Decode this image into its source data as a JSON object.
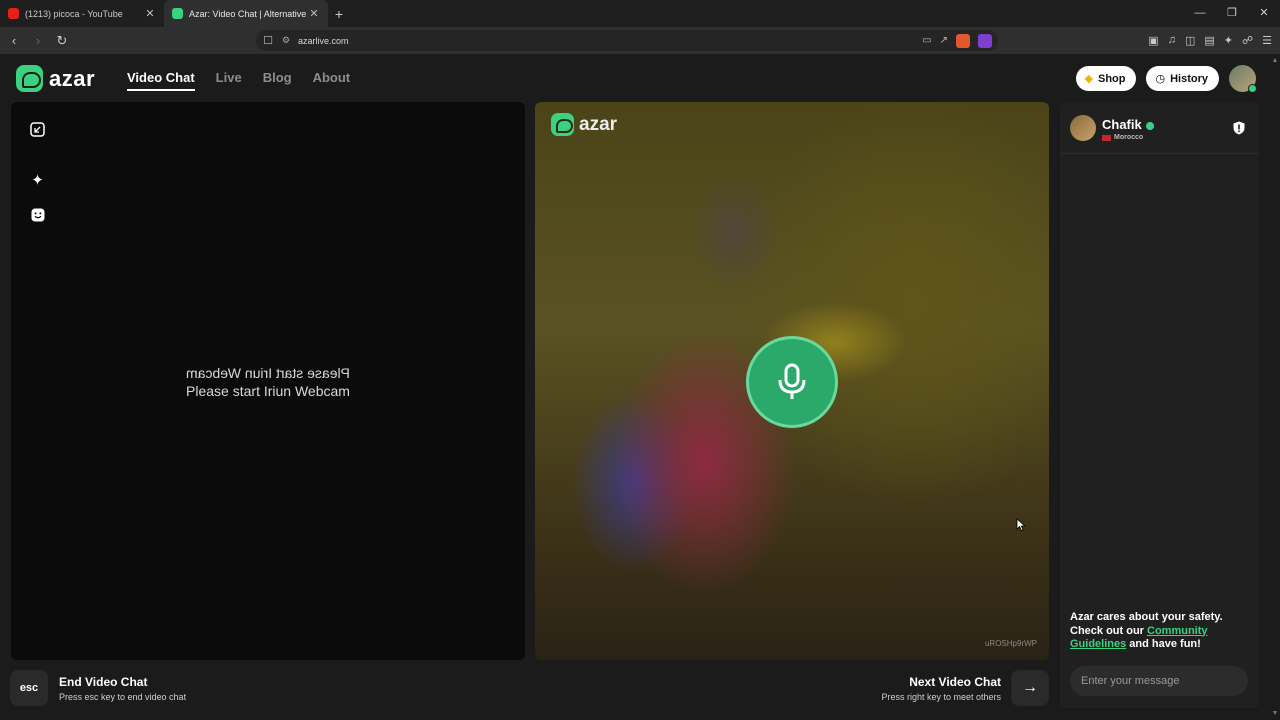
{
  "browser": {
    "tabs": [
      {
        "title": "(1213) picoca - YouTube",
        "active": false,
        "favicon_color": "#e62117"
      },
      {
        "title": "Azar: Video Chat | Alternative",
        "active": true,
        "favicon_color": "#3ad281"
      }
    ],
    "url": "azarlive.com",
    "window_controls": {
      "minimize": "—",
      "restore": "❐",
      "close": "✕"
    },
    "new_tab": "+"
  },
  "header": {
    "logo_text": "azar",
    "nav": [
      {
        "label": "Video Chat",
        "active": true
      },
      {
        "label": "Live",
        "active": false
      },
      {
        "label": "Blog",
        "active": false
      },
      {
        "label": "About",
        "active": false
      }
    ],
    "shop_label": "Shop",
    "history_label": "History"
  },
  "left_pane": {
    "webcam_mirrored": "Please start Iriun Webcam",
    "webcam_text": "Please start Iriun Webcam"
  },
  "video_pane": {
    "logo_text": "azar",
    "watermark": "uROSHp9rWP"
  },
  "chat": {
    "peer_name": "Chafik",
    "peer_country": "Morocco",
    "safety_text_1": "Azar cares about your safety. Check out our ",
    "safety_link": "Community Guidelines",
    "safety_text_2": " and have fun!",
    "message_placeholder": "Enter your message"
  },
  "bottom": {
    "esc_key": "esc",
    "end_title": "End Video Chat",
    "end_sub": "Press esc key to end video chat",
    "next_title": "Next Video Chat",
    "next_sub": "Press right key to meet others",
    "next_icon": "→"
  },
  "colors": {
    "brand_green": "#3ad281",
    "mic_green": "#2aa96a"
  }
}
